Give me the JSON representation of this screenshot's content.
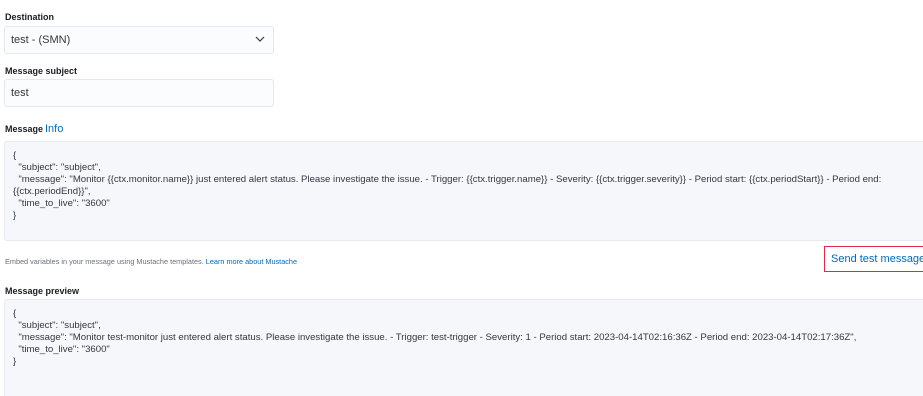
{
  "destination": {
    "label": "Destination",
    "selected": "test - (SMN)",
    "chevron_icon": "chevron-down-icon"
  },
  "subject": {
    "label": "Message subject",
    "value": "test"
  },
  "message": {
    "label": "Message",
    "info_link": "Info",
    "lines": [
      "{",
      "  \"subject\": \"subject\",",
      "  \"message\": \"Monitor {{ctx.monitor.name}} just entered alert status. Please investigate the issue. - Trigger: {{ctx.trigger.name}} - Severity: {{ctx.trigger.severity}} - Period start: {{ctx.periodStart}} - Period end: {{ctx.periodEnd}}\",",
      "  \"time_to_live\": \"3600\"",
      "}"
    ]
  },
  "help": {
    "text": "Embed variables in your message using Mustache templates. ",
    "link": "Learn more about Mustache"
  },
  "send_test_button": "Send test message",
  "preview": {
    "label": "Message preview",
    "lines": [
      "{",
      "  \"subject\": \"subject\",",
      "  \"message\": \"Monitor test-monitor just entered alert status. Please investigate the issue. - Trigger: test-trigger - Severity: 1 - Period start: 2023-04-14T02:16:36Z - Period end: 2023-04-14T02:17:36Z\",",
      "  \"time_to_live\": \"3600\"",
      "}"
    ]
  },
  "colors": {
    "link": "#006bb8",
    "button_border": "#e0294d",
    "code_background": "#f5f7fa"
  }
}
